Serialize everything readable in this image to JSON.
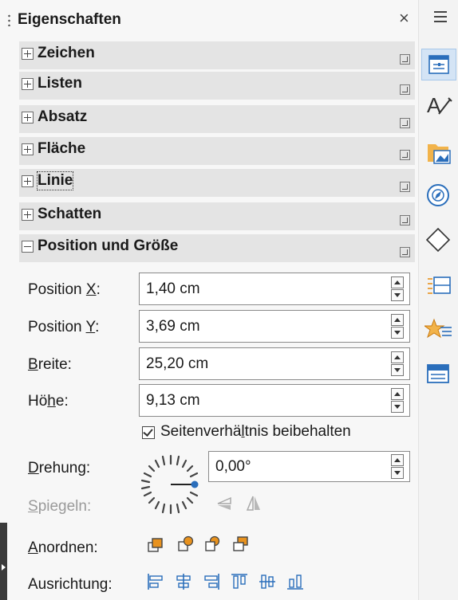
{
  "panel": {
    "title": "Eigenschaften",
    "close_glyph": "×"
  },
  "sections": [
    {
      "label": "Zeichen",
      "state": "collapsed"
    },
    {
      "label": "Listen",
      "state": "collapsed"
    },
    {
      "label": "Absatz",
      "state": "collapsed"
    },
    {
      "label": "Fläche",
      "state": "collapsed"
    },
    {
      "label": "Linie",
      "state": "collapsed"
    },
    {
      "label": "Schatten",
      "state": "collapsed"
    },
    {
      "label": "Position und Größe",
      "state": "expanded"
    }
  ],
  "position_size": {
    "pos_x": {
      "pre": "Position ",
      "key": "X",
      "post": ":",
      "value": "1,40 cm"
    },
    "pos_y": {
      "pre": "Position ",
      "key": "Y",
      "post": ":",
      "value": "3,69 cm"
    },
    "width": {
      "pre": "",
      "key": "B",
      "post": "reite:",
      "value": "25,20 cm"
    },
    "height": {
      "pre": "Hö",
      "key": "h",
      "post": "e:",
      "value": "9,13 cm"
    },
    "keep_ratio": {
      "pre": "Seitenverhä",
      "key": "l",
      "post": "tnis beibehalten",
      "checked": true
    },
    "rotation": {
      "pre": "",
      "key": "D",
      "post": "rehung:",
      "value": "0,00°"
    },
    "flip": {
      "pre": "",
      "key": "S",
      "post": "piegeln:"
    },
    "arrange": {
      "pre": "",
      "key": "A",
      "post": "nordnen:"
    },
    "align": {
      "pre": "Ausrichtung:"
    }
  },
  "sidebar_tabs": [
    "properties-icon",
    "styles-icon",
    "gallery-icon",
    "navigator-icon",
    "shapes-icon",
    "master-slides-icon",
    "animation-icon",
    "slide-transition-icon"
  ],
  "colors": {
    "accent": "#2a6ebb",
    "orange": "#e8921e",
    "header_bg": "#e4e4e4"
  }
}
